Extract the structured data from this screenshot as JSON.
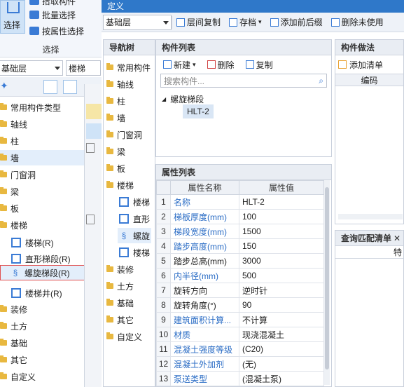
{
  "ribbon": {
    "select_label": "选择",
    "items": [
      "拾取构件",
      "批量选择",
      "按属性选择"
    ],
    "group_label": "选择"
  },
  "filter": {
    "floor": "基础层",
    "category": "楼梯"
  },
  "left_tree": {
    "items": [
      {
        "label": "常用构件类型",
        "type": "folder"
      },
      {
        "label": "轴线",
        "type": "folder"
      },
      {
        "label": "柱",
        "type": "folder"
      },
      {
        "label": "墙",
        "type": "folder"
      },
      {
        "label": "门窗洞",
        "type": "folder"
      },
      {
        "label": "梁",
        "type": "folder"
      },
      {
        "label": "板",
        "type": "folder"
      },
      {
        "label": "楼梯",
        "type": "folder"
      },
      {
        "label": "楼梯(R)",
        "type": "item"
      },
      {
        "label": "直形梯段(R)",
        "type": "item"
      },
      {
        "label": "螺旋梯段(R)",
        "type": "item"
      },
      {
        "label": "楼梯井(R)",
        "type": "item"
      },
      {
        "label": "装修",
        "type": "folder"
      },
      {
        "label": "土方",
        "type": "folder"
      },
      {
        "label": "基础",
        "type": "folder"
      },
      {
        "label": "其它",
        "type": "folder"
      },
      {
        "label": "自定义",
        "type": "folder"
      }
    ]
  },
  "window_title": "定义",
  "toolbar": {
    "floor_select": "基础层",
    "buttons": [
      "层间复制",
      "存档",
      "添加前后缀",
      "删除未使用"
    ]
  },
  "nav": {
    "title": "导航树",
    "items": [
      "常用构件",
      "轴线",
      "柱",
      "墙",
      "门窗洞",
      "梁",
      "板",
      "楼梯",
      "楼梯",
      "直形",
      "螺旋",
      "楼梯",
      "装修",
      "土方",
      "基础",
      "其它",
      "自定义"
    ]
  },
  "component_list": {
    "title": "构件列表",
    "new_label": "新建",
    "delete_label": "删除",
    "copy_label": "复制",
    "search_placeholder": "搜索构件...",
    "group": "螺旋梯段",
    "item": "HLT-2"
  },
  "properties": {
    "title": "属性列表",
    "header_name": "属性名称",
    "header_value": "属性值",
    "rows": [
      {
        "num": "1",
        "name": "名称",
        "value": "HLT-2",
        "blue": true
      },
      {
        "num": "2",
        "name": "梯板厚度(mm)",
        "value": "100",
        "blue": true
      },
      {
        "num": "3",
        "name": "梯段宽度(mm)",
        "value": "1500",
        "blue": true
      },
      {
        "num": "4",
        "name": "踏步高度(mm)",
        "value": "150",
        "blue": true
      },
      {
        "num": "5",
        "name": "踏步总高(mm)",
        "value": "3000",
        "blue": false
      },
      {
        "num": "6",
        "name": "内半径(mm)",
        "value": "500",
        "blue": true
      },
      {
        "num": "7",
        "name": "旋转方向",
        "value": "逆时针",
        "blue": false
      },
      {
        "num": "8",
        "name": "旋转角度(°)",
        "value": "90",
        "blue": false
      },
      {
        "num": "9",
        "name": "建筑面积计算...",
        "value": "不计算",
        "blue": true
      },
      {
        "num": "10",
        "name": "材质",
        "value": "现浇混凝土",
        "blue": true
      },
      {
        "num": "11",
        "name": "混凝土强度等级",
        "value": "(C20)",
        "blue": true
      },
      {
        "num": "12",
        "name": "混凝土外加剂",
        "value": "(无)",
        "blue": true
      },
      {
        "num": "13",
        "name": "泵送类型",
        "value": "(混凝土泵)",
        "blue": true
      }
    ]
  },
  "methods": {
    "title": "构件做法",
    "add_label": "添加清单",
    "col_code": "编码"
  },
  "match": {
    "title": "查询匹配清单",
    "col": "特"
  }
}
